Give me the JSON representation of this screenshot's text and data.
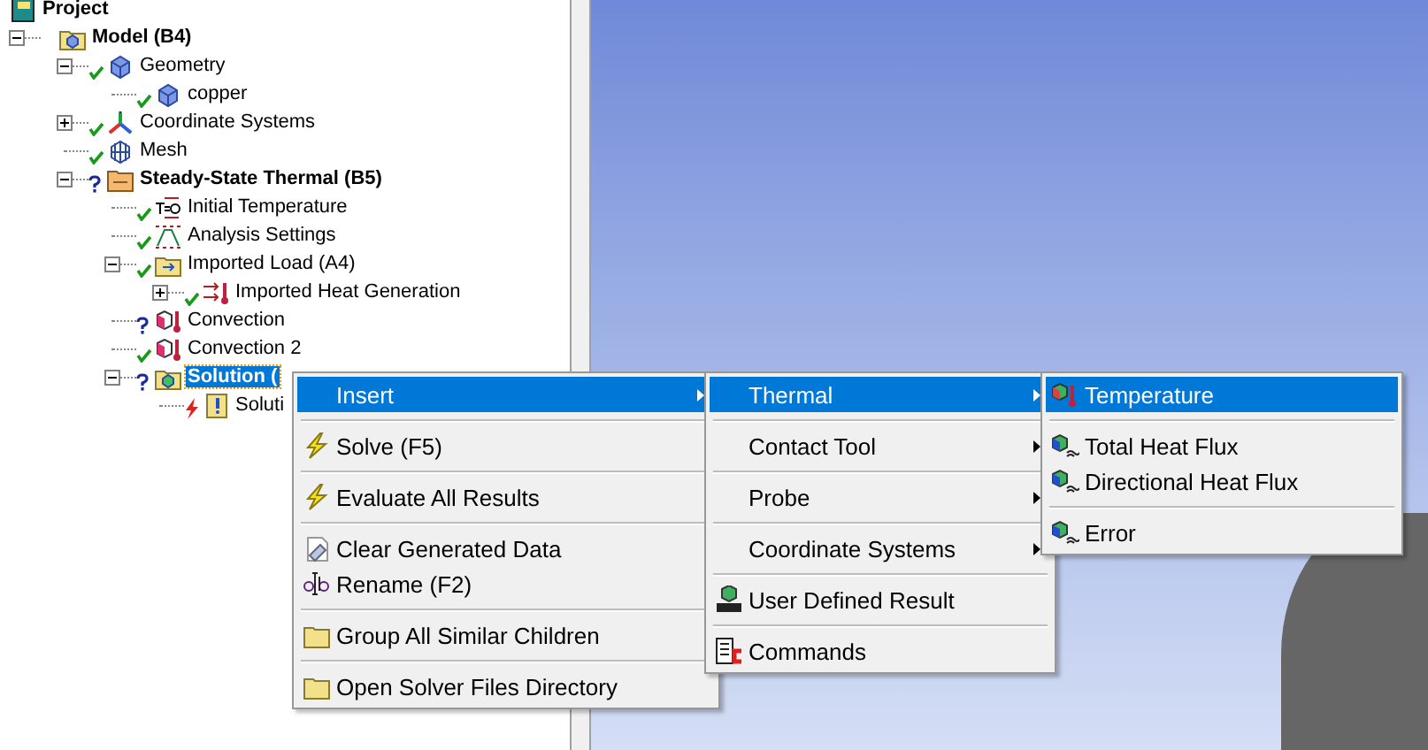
{
  "tree": {
    "label": "Project",
    "kind": "project",
    "children": [
      {
        "label": "Model (B4)",
        "kind": "model",
        "bold": true,
        "expanded": true,
        "selected": false,
        "children": [
          {
            "label": "Geometry",
            "kind": "geometry",
            "expanded": true,
            "complete": true,
            "selected": false,
            "children": [
              {
                "label": "copper",
                "kind": "body",
                "complete": true,
                "selected": false
              }
            ]
          },
          {
            "label": "Coordinate Systems",
            "kind": "axes",
            "expanded": false,
            "complete": true,
            "selected": false
          },
          {
            "label": "Mesh",
            "kind": "mesh",
            "complete": true,
            "selected": false
          },
          {
            "label": "Steady-State Thermal (B5)",
            "kind": "analysis",
            "bold": true,
            "expanded": true,
            "complete": false,
            "selected": false,
            "children": [
              {
                "label": "Initial Temperature",
                "kind": "initial",
                "complete": true,
                "selected": false
              },
              {
                "label": "Analysis Settings",
                "kind": "settings",
                "complete": true,
                "selected": false
              },
              {
                "label": "Imported Load (A4)",
                "kind": "load-folder",
                "expanded": true,
                "complete": true,
                "selected": false,
                "children": [
                  {
                    "label": "Imported Heat Generation",
                    "kind": "load",
                    "expanded": false,
                    "complete": true,
                    "selected": false
                  }
                ]
              },
              {
                "label": "Convection",
                "kind": "convection",
                "complete": false,
                "selected": false
              },
              {
                "label": "Convection 2",
                "kind": "convection",
                "complete": true,
                "selected": false
              },
              {
                "label": "Solution (",
                "kind": "solution",
                "bold": true,
                "expanded": true,
                "complete": false,
                "selected": true,
                "children": [
                  {
                    "label": "Soluti",
                    "kind": "solution-info",
                    "failed": true,
                    "selected": false
                  }
                ]
              }
            ]
          }
        ]
      }
    ]
  },
  "menus": [
    {
      "groups": [
        [
          {
            "label": "Insert",
            "kind": "plain",
            "submenu": true,
            "selected": true
          }
        ],
        [
          {
            "label": "Solve (F5)",
            "kind": "lightning",
            "submenu": false,
            "selected": false
          }
        ],
        [
          {
            "label": "Evaluate All Results",
            "kind": "lightning",
            "submenu": false,
            "selected": false
          }
        ],
        [
          {
            "label": "Clear Generated Data",
            "kind": "eraser",
            "submenu": false,
            "selected": false
          },
          {
            "label": "Rename (F2)",
            "kind": "rename",
            "submenu": false,
            "selected": false
          }
        ],
        [
          {
            "label": "Group All Similar Children",
            "kind": "folder",
            "submenu": false,
            "selected": false
          }
        ],
        [
          {
            "label": "Open Solver Files Directory",
            "kind": "folder",
            "submenu": false,
            "selected": false
          }
        ]
      ]
    },
    {
      "groups": [
        [
          {
            "label": "Thermal",
            "kind": "plain",
            "submenu": true,
            "selected": true
          }
        ],
        [
          {
            "label": "Contact Tool",
            "kind": "plain",
            "submenu": true,
            "selected": false
          }
        ],
        [
          {
            "label": "Probe",
            "kind": "plain",
            "submenu": true,
            "selected": false
          }
        ],
        [
          {
            "label": "Coordinate Systems",
            "kind": "plain",
            "submenu": true,
            "selected": false
          }
        ],
        [
          {
            "label": "User Defined Result",
            "kind": "user",
            "submenu": false,
            "selected": false
          }
        ],
        [
          {
            "label": "Commands",
            "kind": "commands",
            "submenu": false,
            "selected": false
          }
        ]
      ]
    },
    {
      "groups": [
        [
          {
            "label": "Temperature",
            "kind": "temperature",
            "submenu": false,
            "selected": true
          }
        ],
        [
          {
            "label": "Total Heat Flux",
            "kind": "flux",
            "submenu": false,
            "selected": false
          },
          {
            "label": "Directional Heat Flux",
            "kind": "flux",
            "submenu": false,
            "selected": false
          }
        ],
        [
          {
            "label": "Error",
            "kind": "flux",
            "submenu": false,
            "selected": false
          }
        ]
      ]
    }
  ]
}
